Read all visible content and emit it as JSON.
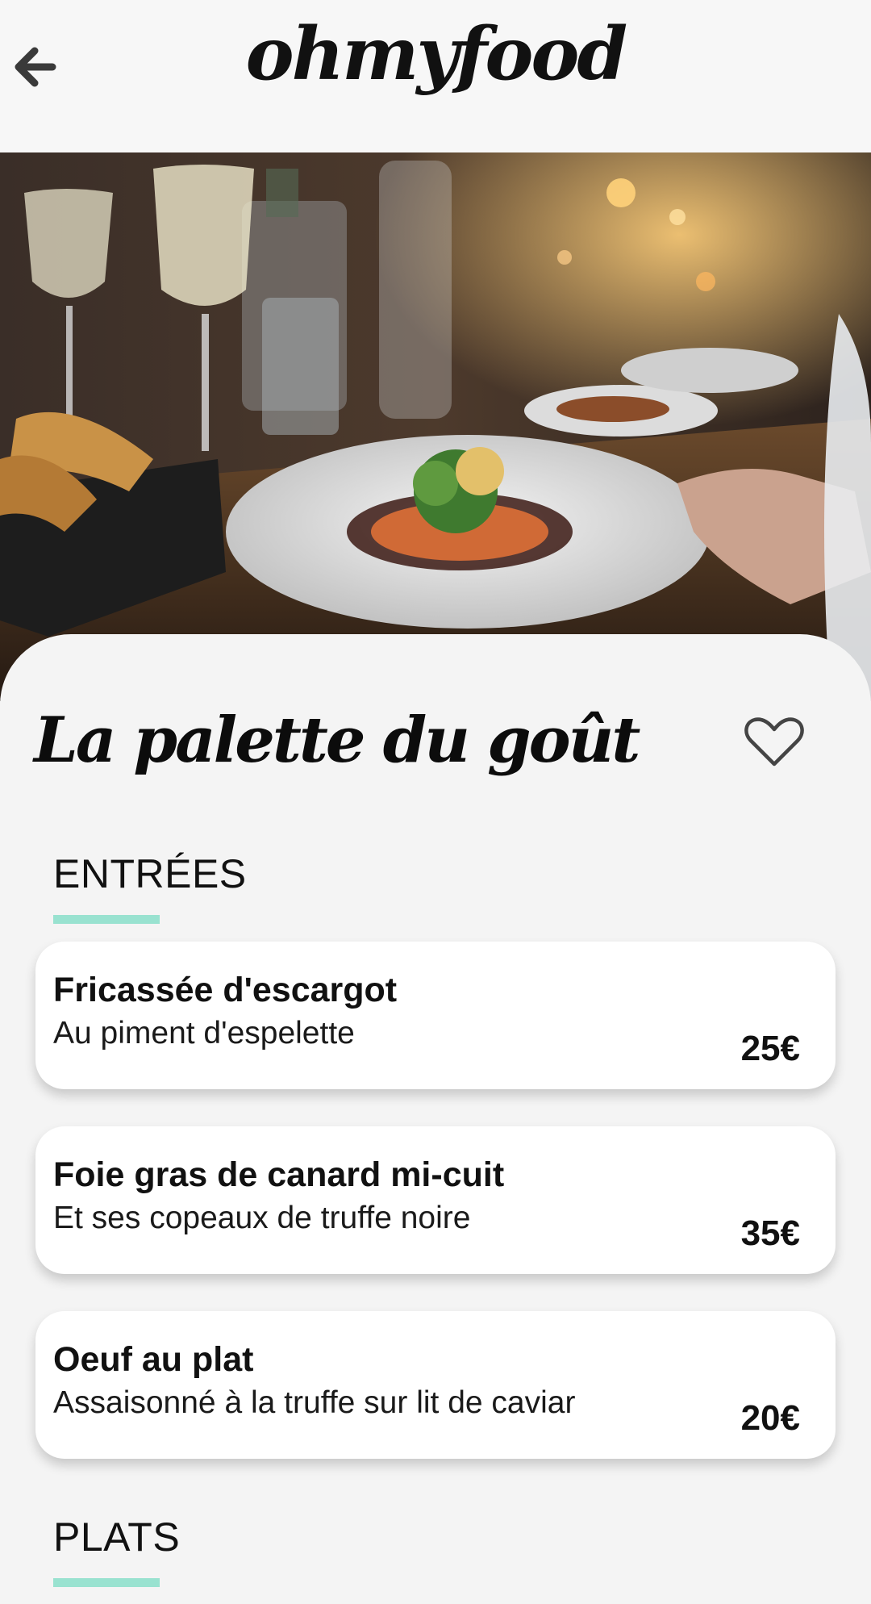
{
  "header": {
    "logo": "ohmyfood",
    "back_icon": "arrow-left-icon"
  },
  "hero": {
    "image_alt": "restaurant-table-photo"
  },
  "restaurant": {
    "name": "La palette du goût",
    "favorite_icon": "heart-outline-icon"
  },
  "sections": [
    {
      "title": "ENTRÉES",
      "accent_color": "#99e2d0",
      "items": [
        {
          "name": "Fricassée d'escargot",
          "description": "Au piment d'espelette",
          "price": "25€"
        },
        {
          "name": "Foie gras de canard mi-cuit",
          "description": "Et ses copeaux de truffe noire",
          "price": "35€"
        },
        {
          "name": "Oeuf au plat",
          "description": "Assaisonné à la truffe sur lit de caviar",
          "price": "20€"
        }
      ]
    },
    {
      "title": "PLATS",
      "accent_color": "#99e2d0",
      "items": []
    }
  ]
}
